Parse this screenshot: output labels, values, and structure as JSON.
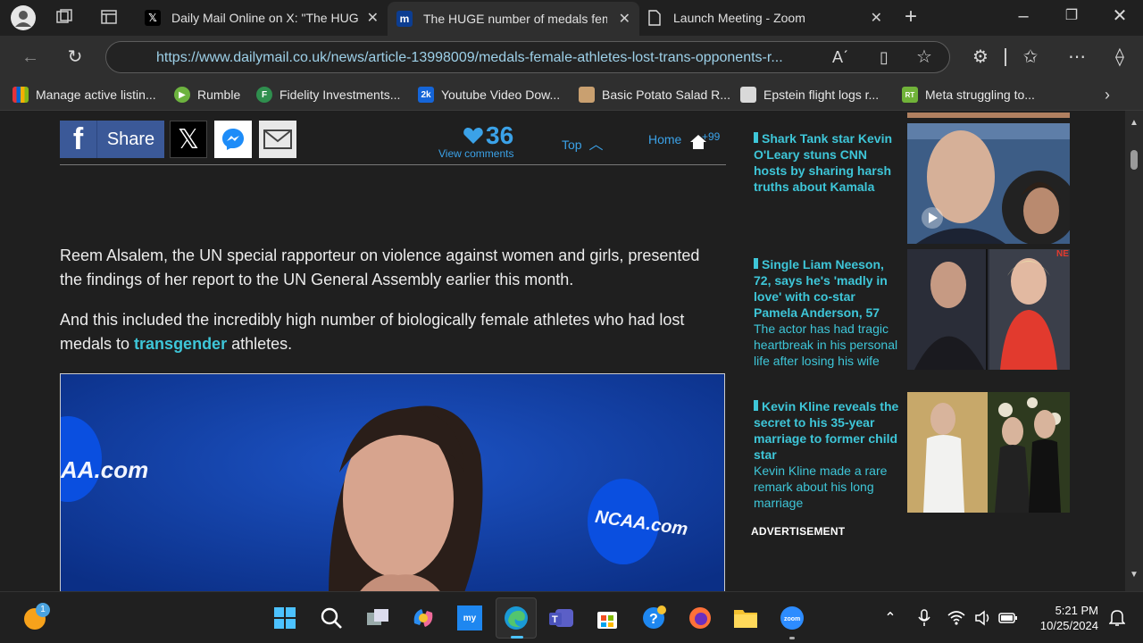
{
  "tabs": [
    {
      "title": "Daily Mail Online on X: \"The HUGE number of medals female",
      "favicon": "x-logo-icon"
    },
    {
      "title": "The HUGE number of medals female athletes lost",
      "favicon": "dailymail-logo-icon"
    },
    {
      "title": "Launch Meeting - Zoom",
      "favicon": "document-icon"
    }
  ],
  "address": {
    "url": "https://www.dailymail.co.uk/news/article-13998009/medals-female-athletes-lost-trans-opponents-r..."
  },
  "bookmarks": [
    {
      "label": "Manage active listin...",
      "color": "#d63b2e",
      "letter": ""
    },
    {
      "label": "Rumble",
      "color": "#6db33f",
      "letter": "▶"
    },
    {
      "label": "Fidelity Investments...",
      "color": "#2f8f4e",
      "letter": "F"
    },
    {
      "label": "Youtube Video Dow...",
      "color": "#1565d8",
      "letter": "2k"
    },
    {
      "label": "Basic Potato Salad R...",
      "color": "#c9a070",
      "letter": ""
    },
    {
      "label": "Epstein flight logs r...",
      "color": "#d9d9d9",
      "letter": ""
    },
    {
      "label": "Meta struggling to...",
      "color": "#71b339",
      "letter": "RT"
    }
  ],
  "share": {
    "facebook_label": "Share",
    "comments_count": "36",
    "view_comments": "View comments",
    "top": "Top",
    "home": "Home",
    "notifications": "+99"
  },
  "article": {
    "p1": "Reem Alsalem, the UN special rapporteur on violence against women and girls, presented the findings of her report to the UN General Assembly earlier this month.",
    "p2_before": "And this included the incredibly high number of biologically female athletes who had lost medals to ",
    "p2_link": "transgender",
    "p2_after": " athletes.",
    "photo_text_left": "AA.com",
    "photo_text_right": "NCAA.com"
  },
  "sidebar": [
    {
      "title": "Shark Tank star Kevin O'Leary stuns CNN hosts by sharing harsh truths about Kamala",
      "desc": ""
    },
    {
      "title": "Single Liam Neeson, 72, says he's 'madly in love' with co-star Pamela Anderson, 57",
      "desc": "The actor has had tragic heartbreak in his personal life after losing his wife"
    },
    {
      "title": "Kevin Kline reveals the secret to his 35-year marriage to former child star",
      "desc": "Kevin Kline made a rare remark about his long marriage"
    }
  ],
  "advertisement_label": "ADVERTISEMENT",
  "taskbar": {
    "time": "5:21 PM",
    "date": "10/25/2024",
    "badge": "1"
  },
  "colors": {
    "accent_link": "#3ec6d8",
    "comment_blue": "#3ba2e8",
    "facebook": "#3b5998"
  }
}
